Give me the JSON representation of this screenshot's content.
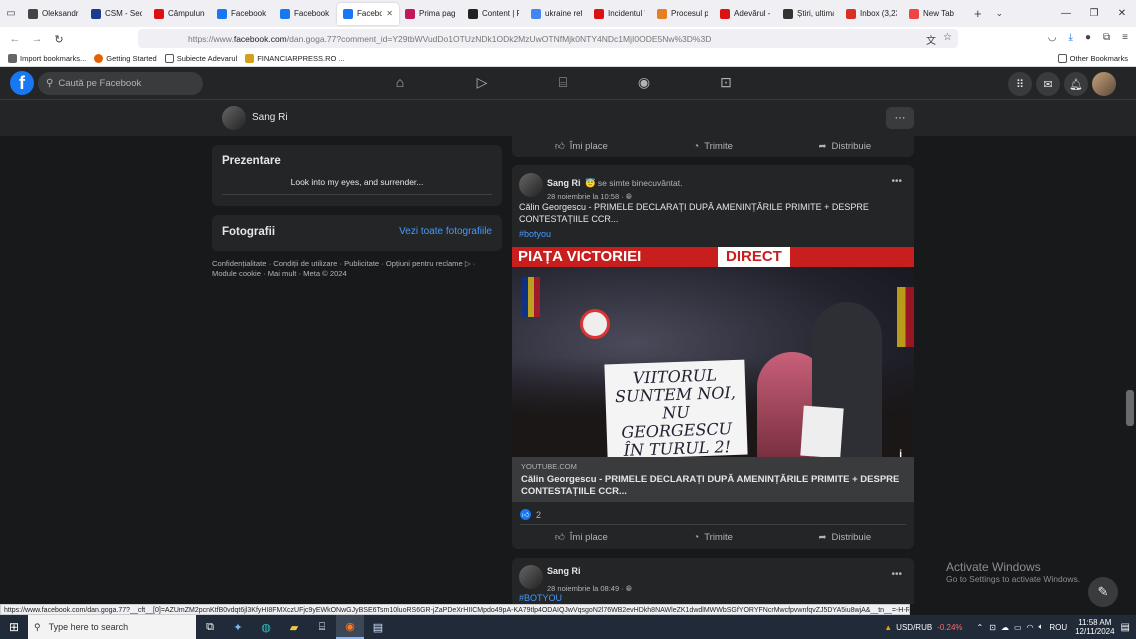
{
  "tabs": [
    {
      "label": "Oleksandra",
      "icon_color": "#444444"
    },
    {
      "label": "CSM - Secți",
      "icon_color": "#1a3c8a"
    },
    {
      "label": "Câmpulung",
      "icon_color": "#d11"
    },
    {
      "label": "Facebook",
      "icon_color": "#1877f2"
    },
    {
      "label": "Facebook",
      "icon_color": "#1877f2"
    },
    {
      "label": "Facebook",
      "icon_color": "#1877f2",
      "active": true
    },
    {
      "label": "Prima pagi",
      "icon_color": "#c2185b"
    },
    {
      "label": "Content | R",
      "icon_color": "#222"
    },
    {
      "label": "ukraine refu",
      "icon_color": "#4285f4"
    },
    {
      "label": "Incidentul î",
      "icon_color": "#d11"
    },
    {
      "label": "Procesul pe",
      "icon_color": "#e67e22"
    },
    {
      "label": "Adevărul - ",
      "icon_color": "#d11"
    },
    {
      "label": "Știri, ultima",
      "icon_color": "#333"
    },
    {
      "label": "Inbox (3,23",
      "icon_color": "#d93025"
    },
    {
      "label": "New Tab",
      "icon_color": "#e44"
    }
  ],
  "url": {
    "prefix": "https://www.",
    "domain": "facebook.com",
    "path": "/dan.goga.77?comment_id=Y29tbWVudDo1OTUzNDk1ODk2MzUwOTNfMjk0NTY4NDc1MjI0ODE5Nw%3D%3D"
  },
  "bookmarks": [
    "Import bookmarks...",
    "Getting Started",
    "Subiecte Adevarul",
    "FINANCIARPRESS.RO ..."
  ],
  "other_bookmarks": "Other Bookmarks",
  "fb": {
    "search_placeholder": "Caută pe Facebook"
  },
  "profile": {
    "name": "Sang Ri",
    "more": "···"
  },
  "intro": {
    "title": "Prezentare",
    "bio": "Look into my eyes, and surrender..."
  },
  "photos": {
    "title": "Fotografii",
    "see_all": "Vezi toate fotografiile"
  },
  "footer": {
    "line1": "Confidențialitate · Condiții de utilizare · Publicitate · Opțiuni pentru reclame ▷ ·",
    "line2": "Module cookie · Mai mult · Meta © 2024"
  },
  "actions": {
    "like": "Îmi place",
    "send": "Trimite",
    "share": "Distribuie"
  },
  "post1": {
    "author": "Sang Ri",
    "feeling": "😇 se simte binecuvântat.",
    "date": "28 noiembrie la 10:58 · ",
    "text": "Călin Georgescu - PRIMELE DECLARAȚI DUPĂ AMENINȚĂRILE PRIMITE + DESPRE CONTESTAȚIILE CCR...",
    "hashtag": "#botyou",
    "video_banner": "PIAȚA VICTORIEI",
    "video_direct": "DIRECT",
    "sign_text": "VIITORUL SUNTEM NOI, NU GEORGESCU ÎN TURUL 2!",
    "link_source": "YOUTUBE.COM",
    "link_title": "Călin Georgescu - PRIMELE DECLARAȚI DUPĂ AMENINȚĂRILE PRIMITE + DESPRE CONTESTAȚIILE CCR...",
    "reactions": "2"
  },
  "post2": {
    "author": "Sang Ri",
    "date": "28 noiembrie la 08:49 · ",
    "hashtag": "#BOTYOU"
  },
  "watermark": {
    "line1": "Activate Windows",
    "line2": "Go to Settings to activate Windows."
  },
  "status_url": "https://www.facebook.com/dan.goga.77?__cft__[0]=AZUmZM2pcnKtfB0vdqt6jl3KfyHI8FMXczUFjc9yEWkONwGJyBSE6Tsm10luoRS6GR-jZaPDeXrHIICMpdo49pA-KA79tlp4ODAIQJwVqsgoN2l76WB2evHDkh8NAWleZK1dwdlMWWbSGfYORYFNcrMwcfpvwnfqvZJ5DYA5iu8wjA&__tn__=-H-R#?gdj",
  "taskbar": {
    "search_placeholder": "Type here to search",
    "currency": "USD/RUB",
    "currency_change": "-0.24%",
    "lang": "ROU",
    "time": "11:58 AM",
    "date": "12/11/2024"
  },
  "colors": {
    "fb_blue": "#1877f2",
    "fb_dark_bg": "#18191a",
    "card_bg": "#242526",
    "currency_down": "#ff6b6b"
  }
}
